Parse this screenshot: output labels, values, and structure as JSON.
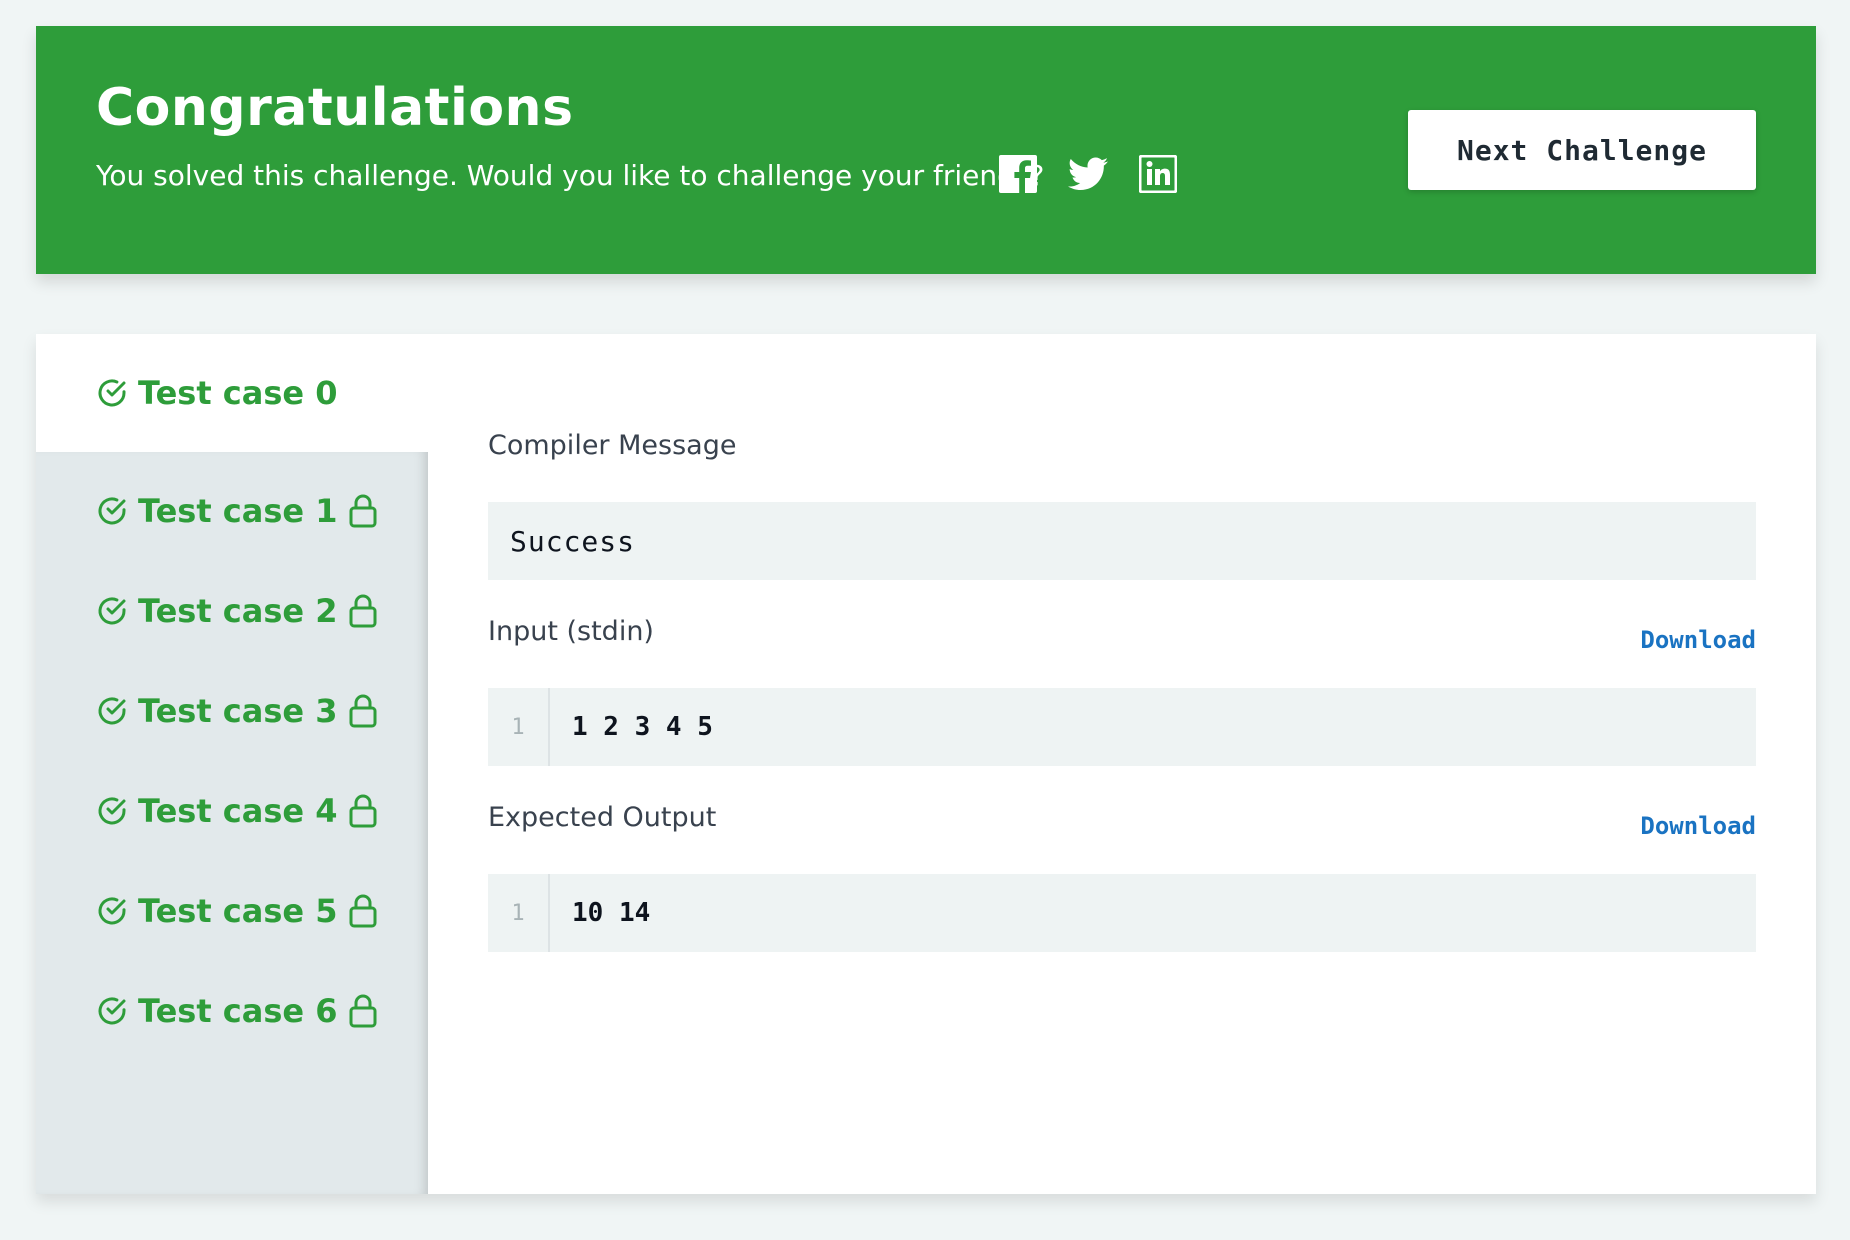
{
  "banner": {
    "title": "Congratulations",
    "message": "You solved this challenge. Would you like to challenge your friends?",
    "share_icons": [
      "facebook-icon",
      "twitter-icon",
      "linkedin-icon"
    ],
    "next_button": "Next Challenge",
    "background": "#2e9d3a"
  },
  "test_cases": [
    {
      "label": "Test case 0",
      "passed": true,
      "locked": false,
      "active": true
    },
    {
      "label": "Test case 1",
      "passed": true,
      "locked": true
    },
    {
      "label": "Test case 2",
      "passed": true,
      "locked": true
    },
    {
      "label": "Test case 3",
      "passed": true,
      "locked": true
    },
    {
      "label": "Test case 4",
      "passed": true,
      "locked": true
    },
    {
      "label": "Test case 5",
      "passed": true,
      "locked": true
    },
    {
      "label": "Test case 6",
      "passed": true,
      "locked": true
    }
  ],
  "details": {
    "compiler_label": "Compiler Message",
    "compiler_message": "Success",
    "input_label": "Input (stdin)",
    "input_download": "Download",
    "input_line_no": "1",
    "input_value": "1 2 3 4 5",
    "output_label": "Expected Output",
    "output_download": "Download",
    "output_line_no": "1",
    "output_value": "10 14"
  },
  "colors": {
    "success_green": "#2e9d3a",
    "link_blue": "#1a73c2"
  }
}
